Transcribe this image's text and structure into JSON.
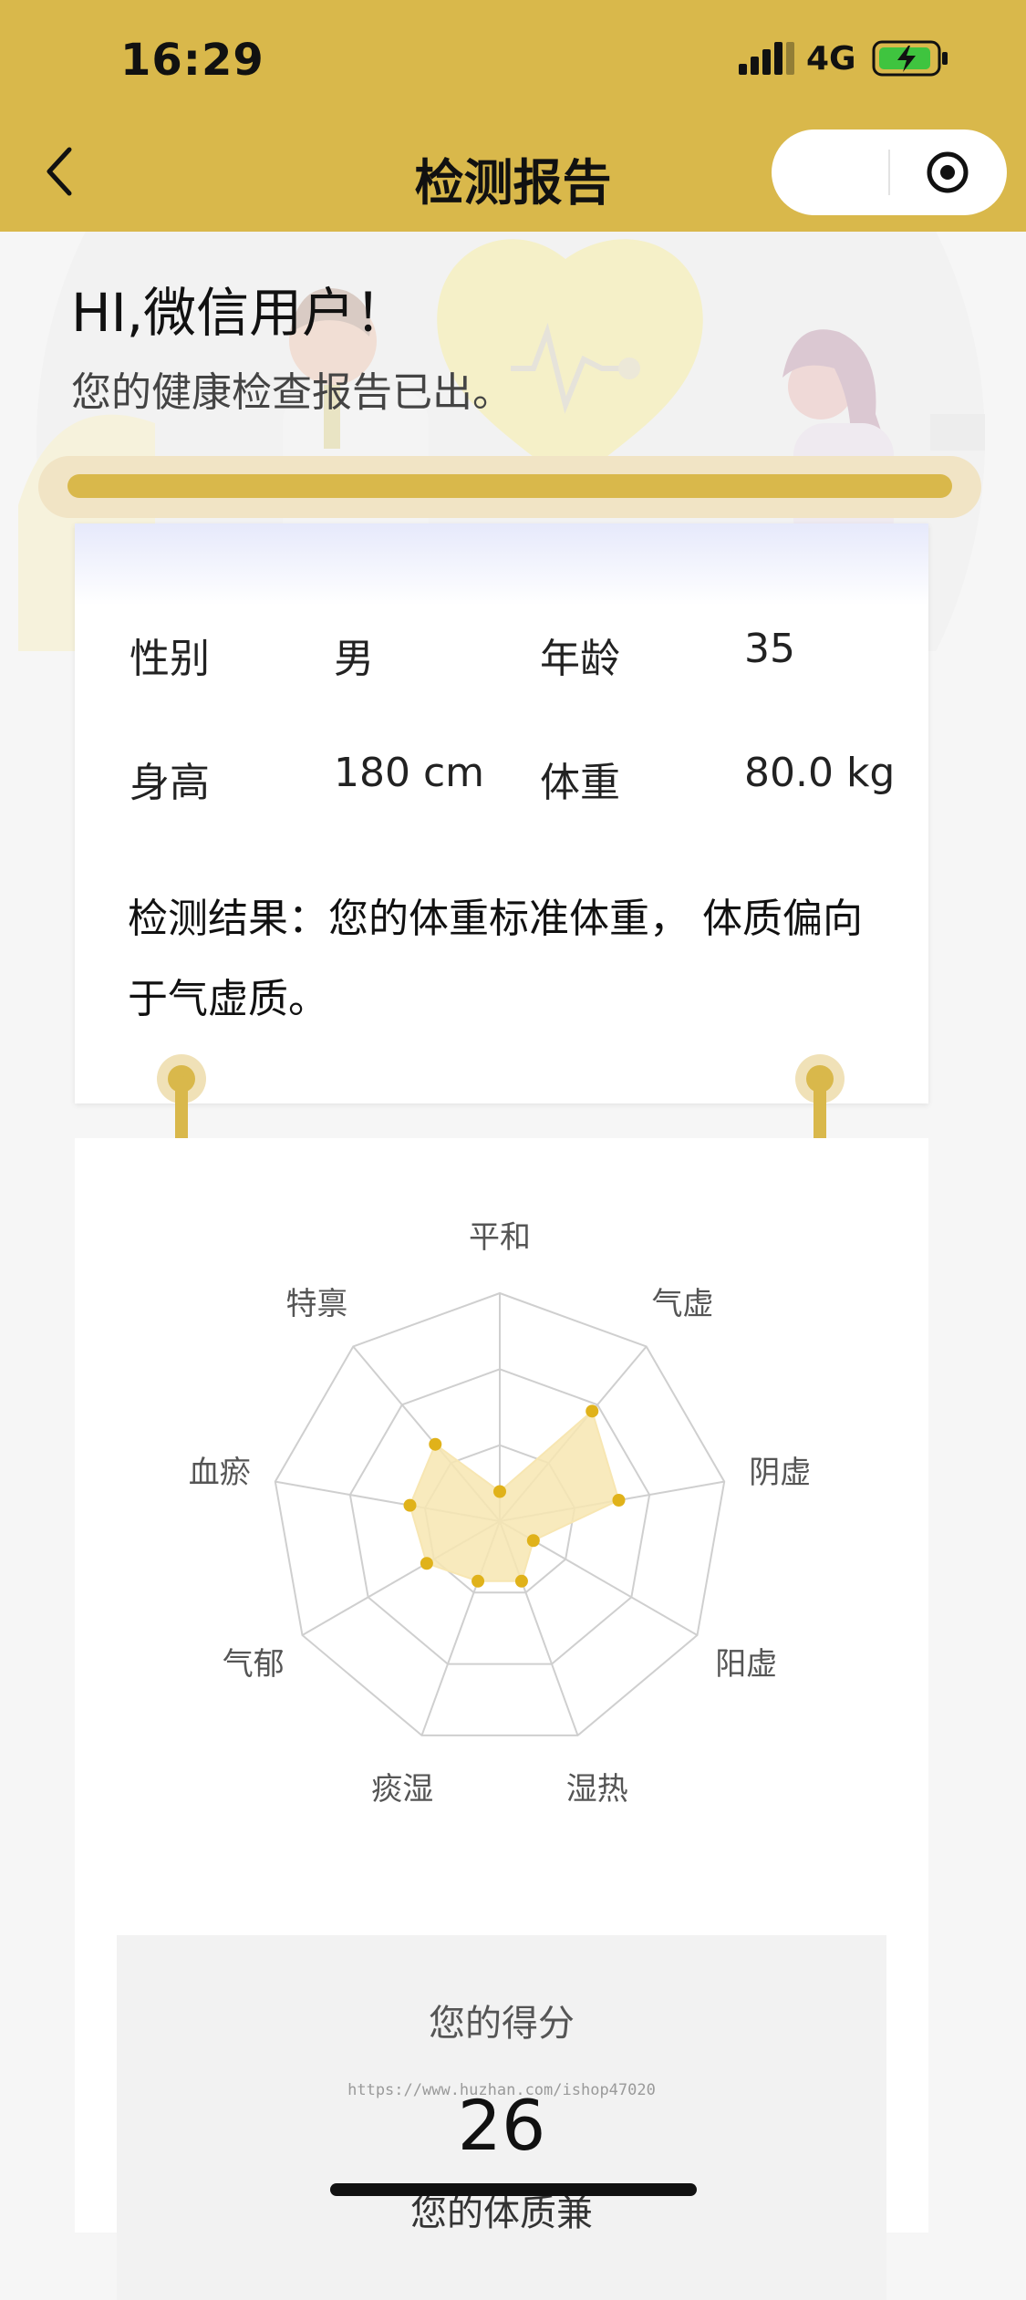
{
  "status_bar": {
    "time": "16:29",
    "network": "4G",
    "battery_color": "#3fc43f"
  },
  "nav": {
    "title": "检测报告",
    "back_icon": "chevron-left-icon",
    "capsule_icon": "target-icon"
  },
  "hero": {
    "greeting": "HI,微信用户！",
    "subtitle": "您的健康检查报告已出。"
  },
  "report": {
    "gender_label": "性别",
    "gender_value": "男",
    "age_label": "年龄",
    "age_value": "35",
    "height_label": "身高",
    "height_value": "180 cm",
    "weight_label": "体重",
    "weight_value": "80.0 kg",
    "result": "检测结果：您的体重标准体重， 体质偏向于气虚质。"
  },
  "chart_data": {
    "type": "radar",
    "categories": [
      "平和",
      "气虚",
      "阴虚",
      "阳虚",
      "湿热",
      "痰湿",
      "气郁",
      "血瘀",
      "特禀"
    ],
    "values": [
      0.13,
      0.63,
      0.53,
      0.17,
      0.28,
      0.28,
      0.37,
      0.4,
      0.44
    ],
    "rings": 3,
    "series_color": "#e0b21a",
    "fill_color": "#f7e6b2"
  },
  "score": {
    "title": "您的得分",
    "value": "26",
    "watermark": "https://www.huzhan.com/ishop47020",
    "subtitle": "您的体质兼"
  },
  "colors": {
    "brand": "#d9b84b",
    "page_bg": "#f6f6f6"
  }
}
